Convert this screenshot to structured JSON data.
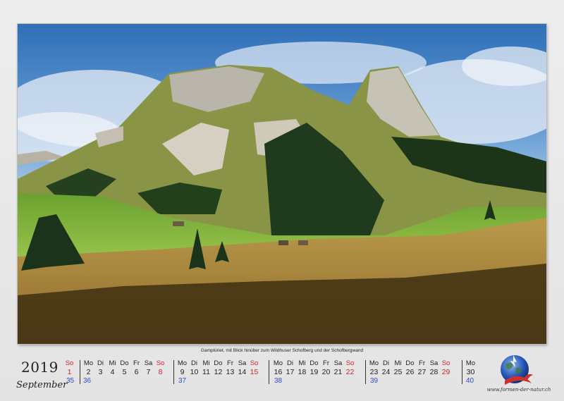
{
  "caption": "Gamplüriet, mit Blick hinüber zum Wildhuser Schofberg und der Schofbergwand",
  "year": "2019",
  "month": "September",
  "website": "www.formen-der-natur.ch",
  "weeks": [
    {
      "days": [
        {
          "name": "So",
          "num": "1",
          "sunday": true
        }
      ],
      "kw": "35"
    },
    {
      "days": [
        {
          "name": "Mo",
          "num": "2"
        },
        {
          "name": "Di",
          "num": "3"
        },
        {
          "name": "Mi",
          "num": "4"
        },
        {
          "name": "Do",
          "num": "5"
        },
        {
          "name": "Fr",
          "num": "6"
        },
        {
          "name": "Sa",
          "num": "7"
        },
        {
          "name": "So",
          "num": "8",
          "sunday": true
        }
      ],
      "kw": "36"
    },
    {
      "days": [
        {
          "name": "Mo",
          "num": "9"
        },
        {
          "name": "Di",
          "num": "10"
        },
        {
          "name": "Mi",
          "num": "11"
        },
        {
          "name": "Do",
          "num": "12"
        },
        {
          "name": "Fr",
          "num": "13"
        },
        {
          "name": "Sa",
          "num": "14"
        },
        {
          "name": "So",
          "num": "15",
          "sunday": true
        }
      ],
      "kw": "37"
    },
    {
      "days": [
        {
          "name": "Mo",
          "num": "16"
        },
        {
          "name": "Di",
          "num": "17"
        },
        {
          "name": "Mi",
          "num": "18"
        },
        {
          "name": "Do",
          "num": "19"
        },
        {
          "name": "Fr",
          "num": "20"
        },
        {
          "name": "Sa",
          "num": "21"
        },
        {
          "name": "So",
          "num": "22",
          "sunday": true
        }
      ],
      "kw": "38"
    },
    {
      "days": [
        {
          "name": "Mo",
          "num": "23"
        },
        {
          "name": "Di",
          "num": "24"
        },
        {
          "name": "Mi",
          "num": "25"
        },
        {
          "name": "Do",
          "num": "26"
        },
        {
          "name": "Fr",
          "num": "27"
        },
        {
          "name": "Sa",
          "num": "28"
        },
        {
          "name": "So",
          "num": "29",
          "sunday": true
        }
      ],
      "kw": "39"
    },
    {
      "days": [
        {
          "name": "Mo",
          "num": "30"
        }
      ],
      "kw": "40"
    }
  ],
  "colors": {
    "sunday": "#d4212a",
    "week_number": "#2b49c8",
    "sky": "#3f7ec4",
    "meadow": "#7fb43a",
    "field": "#a0783a"
  },
  "icons": [
    "globe-logo-icon"
  ]
}
